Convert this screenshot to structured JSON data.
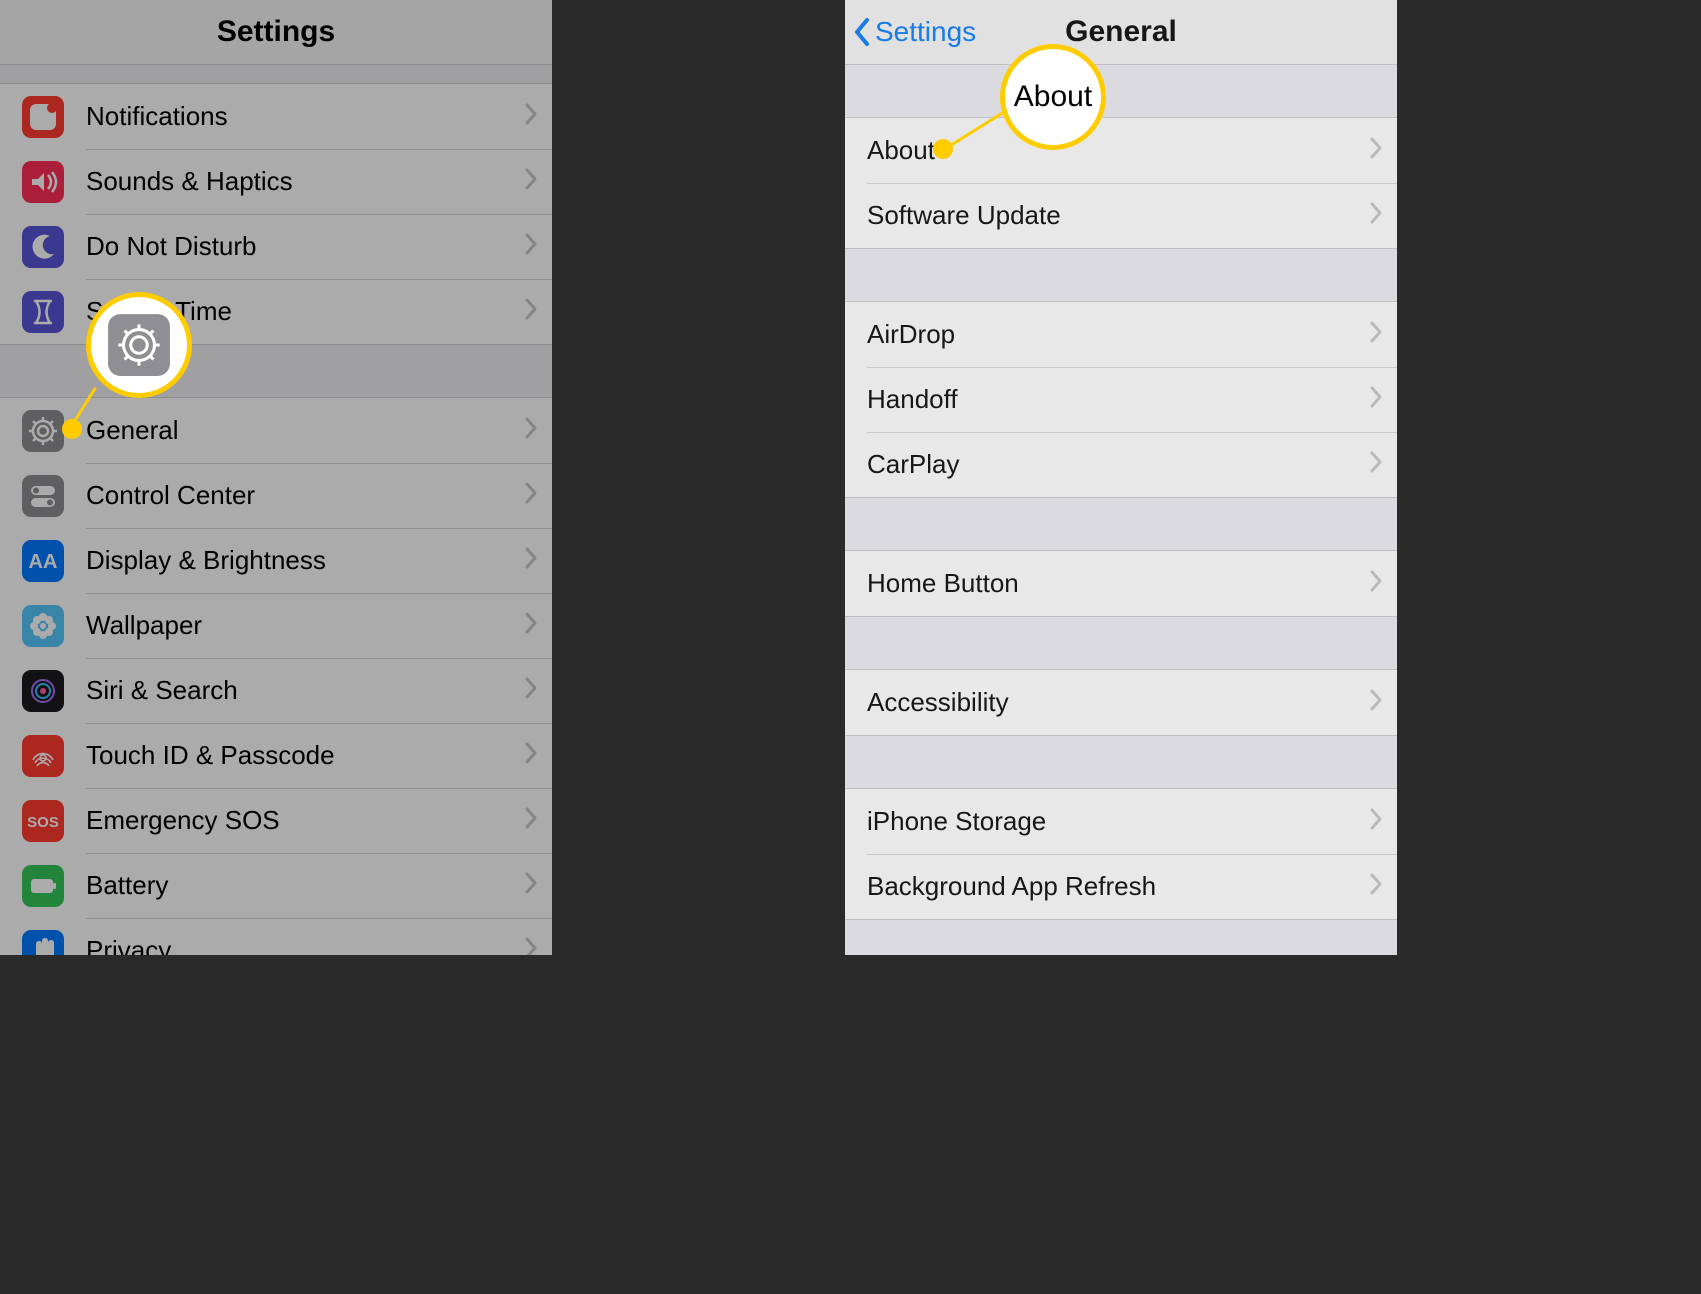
{
  "left": {
    "title": "Settings",
    "groups": [
      {
        "rows": [
          {
            "icon": "ic-notif",
            "iconName": "notifications-icon",
            "label": "Notifications"
          },
          {
            "icon": "ic-sounds",
            "iconName": "sounds-icon",
            "label": "Sounds & Haptics"
          },
          {
            "icon": "ic-dnd",
            "iconName": "moon-icon",
            "label": "Do Not Disturb"
          },
          {
            "icon": "ic-screen",
            "iconName": "hourglass-icon",
            "label": "Screen Time"
          }
        ]
      },
      {
        "rows": [
          {
            "icon": "ic-general",
            "iconName": "gear-icon",
            "label": "General"
          },
          {
            "icon": "ic-control",
            "iconName": "switches-icon",
            "label": "Control Center"
          },
          {
            "icon": "ic-display",
            "iconName": "aa-icon",
            "label": "Display & Brightness"
          },
          {
            "icon": "ic-wall",
            "iconName": "flower-icon",
            "label": "Wallpaper"
          },
          {
            "icon": "ic-siri",
            "iconName": "siri-icon",
            "label": "Siri & Search"
          },
          {
            "icon": "ic-touch",
            "iconName": "fingerprint-icon",
            "label": "Touch ID & Passcode"
          },
          {
            "icon": "ic-sos",
            "iconName": "sos-icon",
            "label": "Emergency SOS"
          },
          {
            "icon": "ic-batt",
            "iconName": "battery-icon",
            "label": "Battery"
          },
          {
            "icon": "ic-priv",
            "iconName": "hand-icon",
            "label": "Privacy"
          }
        ]
      }
    ]
  },
  "right": {
    "back": "Settings",
    "title": "General",
    "groups": [
      {
        "rows": [
          {
            "label": "About"
          },
          {
            "label": "Software Update"
          }
        ]
      },
      {
        "rows": [
          {
            "label": "AirDrop"
          },
          {
            "label": "Handoff"
          },
          {
            "label": "CarPlay"
          }
        ]
      },
      {
        "rows": [
          {
            "label": "Home Button"
          }
        ]
      },
      {
        "rows": [
          {
            "label": "Accessibility"
          }
        ]
      },
      {
        "rows": [
          {
            "label": "iPhone Storage"
          },
          {
            "label": "Background App Refresh"
          }
        ]
      }
    ]
  },
  "callouts": {
    "left": {
      "text": ""
    },
    "right": {
      "text": "About"
    }
  }
}
